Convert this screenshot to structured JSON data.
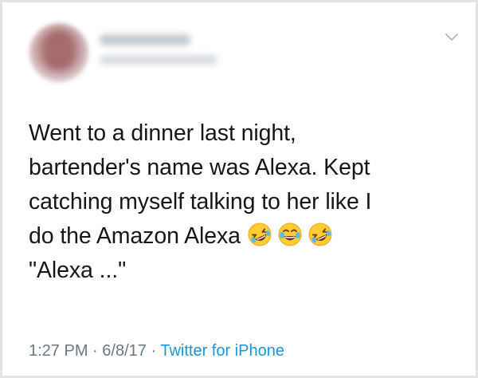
{
  "tweet": {
    "lines": [
      "Went to a dinner last night,",
      "bartender's name was Alexa. Kept",
      "catching myself talking to her like I",
      "do the Amazon Alexa",
      "\"Alexa ...\""
    ],
    "emojis": [
      "rolling-on-floor-laughing",
      "face-with-tears-of-joy",
      "rolling-on-floor-laughing"
    ],
    "time": "1:27 PM",
    "date": "6/8/17",
    "separator": "·",
    "source": "Twitter for iPhone"
  },
  "colors": {
    "text": "#14171a",
    "meta": "#697882",
    "link": "#1b95e0",
    "border": "#e3e3e3"
  },
  "icons": {
    "menu": "chevron-down-icon"
  }
}
